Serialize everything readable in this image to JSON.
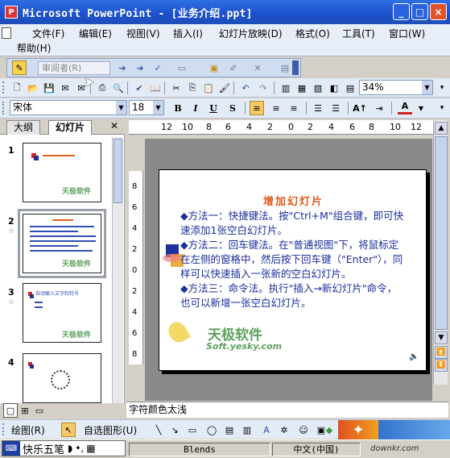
{
  "window": {
    "title": "Microsoft PowerPoint - [业务介绍.ppt]",
    "buttons": [
      "_",
      "□",
      "×"
    ]
  },
  "menu": {
    "items": [
      "文件(F)",
      "编辑(E)",
      "视图(V)",
      "插入(I)",
      "幻灯片放映(D)",
      "格式(O)",
      "工具(T)",
      "窗口(W)",
      "帮助(H)"
    ]
  },
  "reviewer_toolbar": {
    "reviewer_label": "审阅者(R)"
  },
  "standard_toolbar": {
    "zoom": "34%"
  },
  "formatting_toolbar": {
    "font": "宋体",
    "size": "18",
    "bold": "B",
    "italic": "I",
    "underline": "U",
    "shadow": "S"
  },
  "left_pane": {
    "tabs": [
      "大纲",
      "幻灯片"
    ],
    "slide_numbers": [
      "1",
      "2",
      "3",
      "4"
    ],
    "thumb3_text": "自动输入文字和符号",
    "thumb_logo": "天极软件"
  },
  "ruler": {
    "horizontal": [
      "12",
      "10",
      "8",
      "6",
      "4",
      "2",
      "0",
      "2",
      "4",
      "6",
      "8",
      "10",
      "12"
    ],
    "vertical": [
      "8",
      "6",
      "4",
      "2",
      "0",
      "2",
      "4",
      "6",
      "8"
    ]
  },
  "slide": {
    "title": "增加幻灯片",
    "paragraphs": [
      "◆方法一：快捷键法。按\"Ctrl+M\"组合键，即可快速添加1张空白幻灯片。",
      "◆方法二：回车键法。在\"普通视图\"下，将鼠标定在左侧的窗格中，然后按下回车键（\"Enter\"），同样可以快速插入一张新的空白幻灯片。",
      "◆方法三：命令法。执行\"插入→新幻灯片\"命令，也可以新增一张空白幻灯片。"
    ],
    "logo_cn": "天极软件",
    "logo_en": "Soft.yesky.com"
  },
  "notes": {
    "text": "字符颜色太浅"
  },
  "draw_toolbar": {
    "draw_label": "绘图(R)",
    "autoshapes_label": "自选图形(U)"
  },
  "statusbar": {
    "ime": "快乐五笔",
    "design": "Blends",
    "language": "中文(中国)",
    "site": "downkr.com"
  }
}
